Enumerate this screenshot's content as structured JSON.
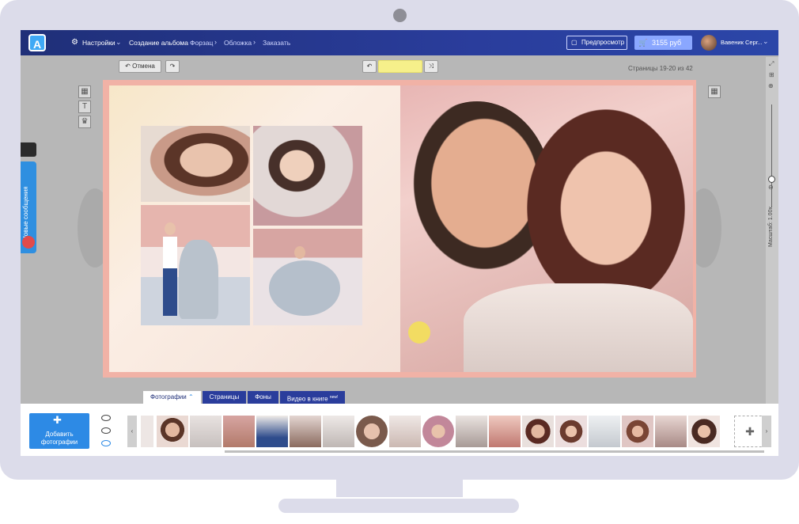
{
  "topbar": {
    "logo": "A",
    "settings_label": "Настройки",
    "breadcrumbs": [
      "Создание альбома",
      "Форзац",
      "Обложка",
      "Заказать"
    ],
    "preview_label": "Предпросмотр",
    "price": "3155 руб",
    "username": "Вавеник Серг..."
  },
  "toolbar": {
    "undo_label": "Отмена",
    "pages_label": "Страницы 19-20 из 42"
  },
  "side": {
    "messages_label": "Новые сообщения"
  },
  "zoom": {
    "label": "Масштаб: 1.00x"
  },
  "tabs": [
    {
      "label": "Фотографии"
    },
    {
      "label": "Страницы"
    },
    {
      "label": "Фоны"
    },
    {
      "label": "Видео в книге"
    }
  ],
  "tab_badge": "new!",
  "bottom": {
    "add_label": "Добавить фотографии"
  },
  "colors": {
    "topbar": "#1f2f78",
    "accent": "#2d8ae5",
    "spread_border": "#f1b2a6"
  }
}
